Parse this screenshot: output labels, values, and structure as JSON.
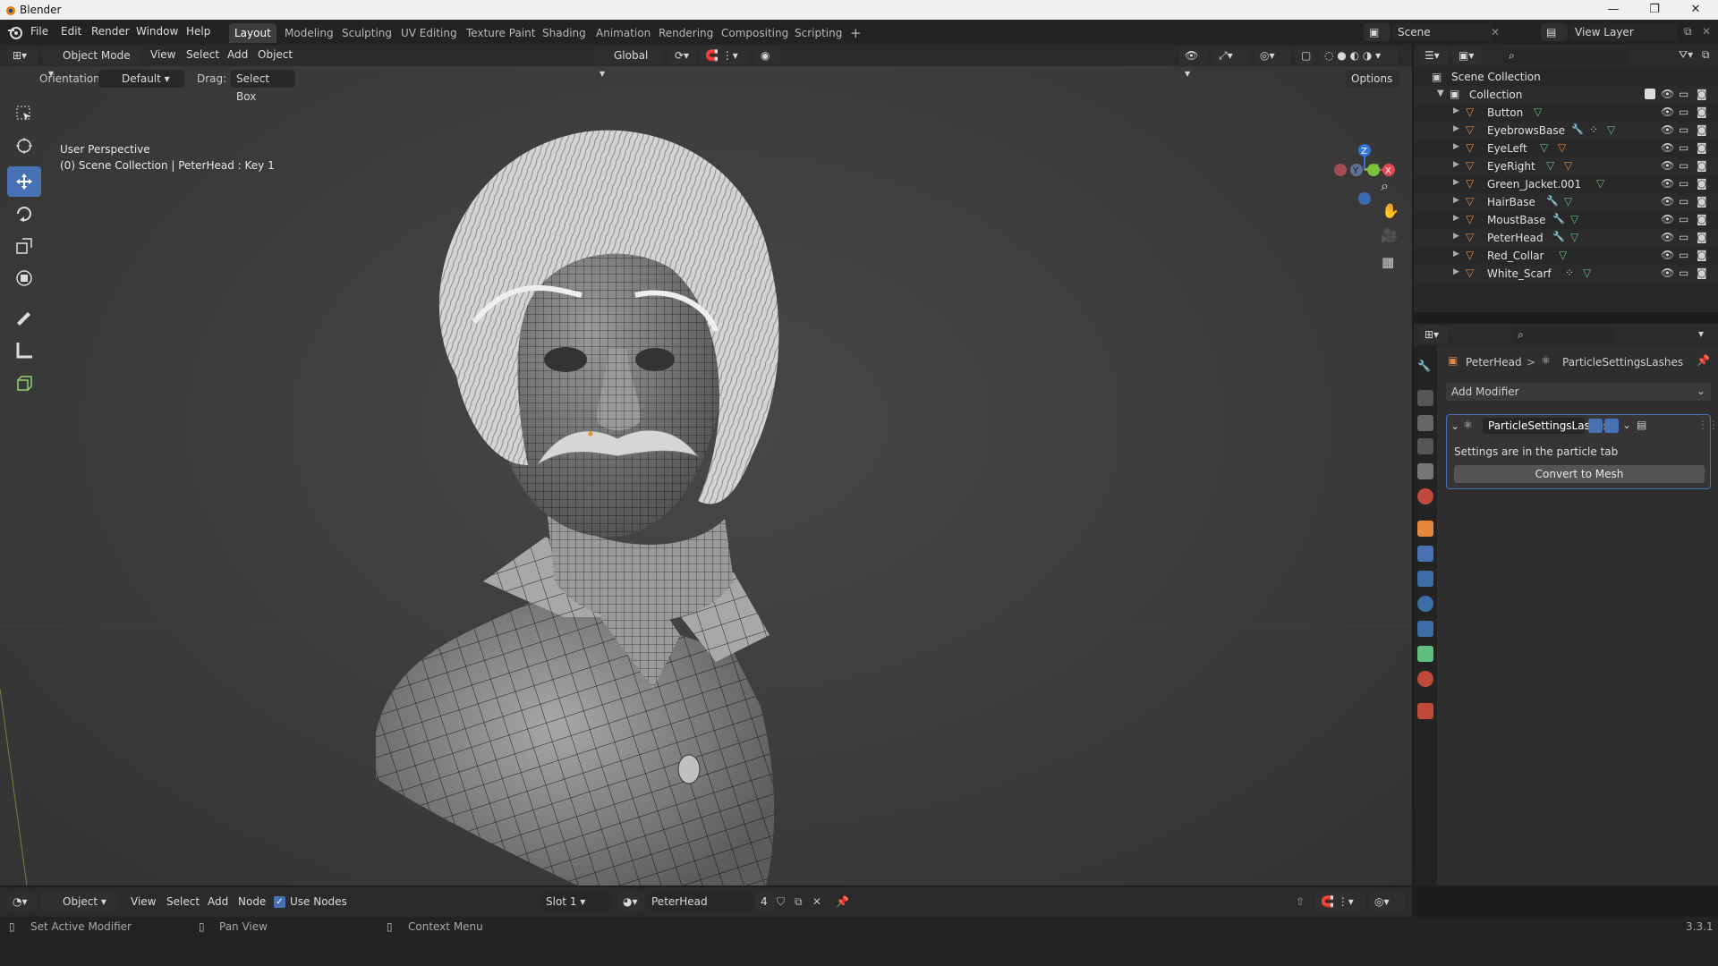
{
  "window": {
    "title": "Blender"
  },
  "menu": [
    "File",
    "Edit",
    "Render",
    "Window",
    "Help"
  ],
  "workspaces": [
    "Layout",
    "Modeling",
    "Sculpting",
    "UV Editing",
    "Texture Paint",
    "Shading",
    "Animation",
    "Rendering",
    "Compositing",
    "Scripting"
  ],
  "active_workspace": "Layout",
  "scene": {
    "name": "Scene",
    "view_layer": "View Layer"
  },
  "viewport_header": {
    "mode": "Object Mode",
    "menus": [
      "View",
      "Select",
      "Add",
      "Object"
    ],
    "transform": "Global",
    "orientation_label": "Orientation:",
    "orientation_value": "Default",
    "drag_label": "Drag:",
    "drag_value": "Select Box",
    "options": "Options"
  },
  "viewport_info": {
    "line1": "User Perspective",
    "line2": "(0) Scene Collection | PeterHead : Key 1"
  },
  "gizmo": {
    "z": "Z",
    "y": "Y",
    "x": "X"
  },
  "outliner": {
    "root": "Scene Collection",
    "collection": "Collection",
    "objects": [
      "Button",
      "EyebrowsBase",
      "EyeLeft",
      "EyeRight",
      "Green_Jacket.001",
      "HairBase",
      "MoustBase",
      "PeterHead",
      "Red_Collar",
      "White_Scarf"
    ]
  },
  "properties": {
    "breadcrumb_object": "PeterHead",
    "breadcrumb_sep": ">",
    "breadcrumb_settings": "ParticleSettingsLashes",
    "add_modifier": "Add Modifier",
    "modifier_name": "ParticleSettingsLashes",
    "modifier_note": "Settings are in the particle tab",
    "convert_button": "Convert to Mesh"
  },
  "node_header": {
    "editor": "Object",
    "menus": [
      "View",
      "Select",
      "Add",
      "Node"
    ],
    "use_nodes_label": "Use Nodes",
    "use_nodes_checked": true,
    "slot": "Slot 1",
    "material": "PeterHead",
    "users": "4"
  },
  "status_bar": {
    "left_action": "Set Active Modifier",
    "middle_action": "Pan View",
    "right_action": "Context Menu",
    "version": "3.3.1"
  },
  "colors": {
    "accent": "#4772b3",
    "object_orange": "#e8863a",
    "mesh_green": "#5fbf7f"
  }
}
